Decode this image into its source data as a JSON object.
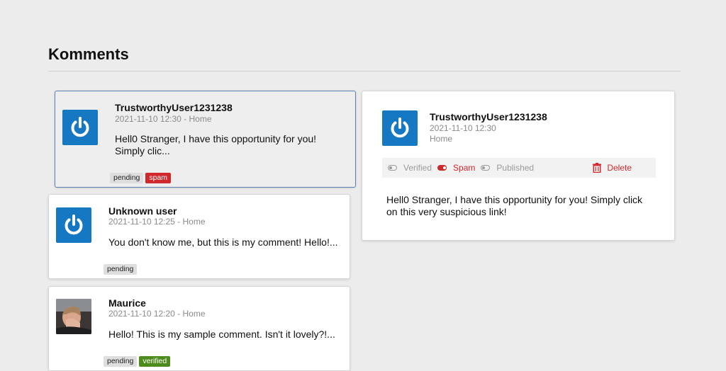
{
  "page": {
    "title": "Komments"
  },
  "comments": [
    {
      "author": "TrustworthyUser1231238",
      "meta": "2021-11-10 12:30 - Home",
      "excerpt_line1": "Hell0 Stranger, I have this opportunity for you!",
      "excerpt_line2": "Simply clic...",
      "tags": [
        "pending",
        "spam"
      ],
      "avatar": "power-icon"
    },
    {
      "author": "Unknown user",
      "meta": "2021-11-10 12:25 - Home",
      "excerpt_line1": "You don't know me, but this is my comment! Hello!...",
      "tags": [
        "pending"
      ],
      "avatar": "power-icon"
    },
    {
      "author": "Maurice",
      "meta": "2021-11-10 12:20 - Home",
      "excerpt_line1": "Hello! This is my sample comment. Isn't it lovely?!...",
      "tags": [
        "pending",
        "verified"
      ],
      "avatar": "user-photo"
    }
  ],
  "detail": {
    "author": "TrustworthyUser1231238",
    "date": "2021-11-10 12:30",
    "page": "Home",
    "toolbar": {
      "verified": "Verified",
      "spam": "Spam",
      "published": "Published",
      "delete": "Delete"
    },
    "text_line1": "Hell0 Stranger, I have this opportunity for you! Simply click",
    "text_line2": "on this very suspicious link!"
  },
  "colors": {
    "accent": "#1678c2",
    "danger": "#d0282b",
    "success": "#4d8c1c"
  }
}
